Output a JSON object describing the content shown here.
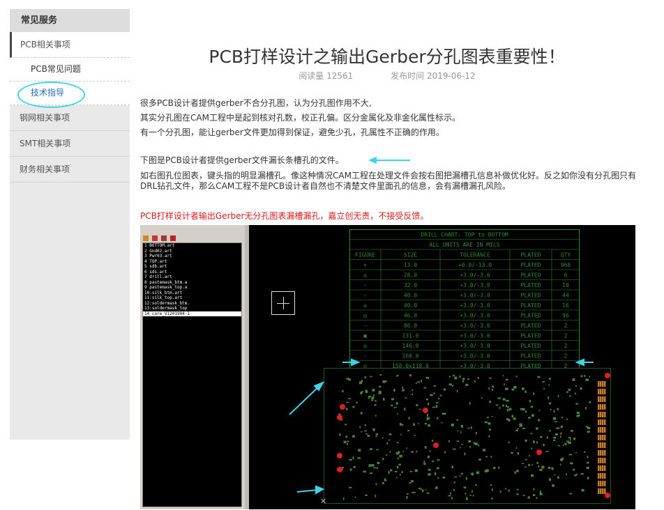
{
  "sidebar": {
    "header": "常见服务",
    "items": [
      {
        "label": "PCB相关事项"
      },
      {
        "label": "PCB常见问题"
      },
      {
        "label": "技术指导"
      },
      {
        "label": "钢网相关事项"
      },
      {
        "label": "SMT相关事项"
      },
      {
        "label": "财务相关事项"
      }
    ]
  },
  "article": {
    "title": "PCB打样设计之输出Gerber分孔图表重要性！",
    "views": "阅读量 12561",
    "date": "发布时间 2019-06-12",
    "p1": "很多PCB设计者提供gerber不合分孔图，认为分孔图作用不大,",
    "p2": "其实分孔图在CAM工程中是起到核对孔数，校正孔偏。区分金属化及非金化属性标示。",
    "p3": "有一个分孔图，能让gerber文件更加得到保证，避免少孔，孔属性不正确的作用。",
    "p4": "下图是PCB设计者提供gerber文件漏长条槽孔的文件。",
    "p5": "如右图孔位图表，键头指的明显漏槽孔。像这种情况CAM工程在处理文件会按右图把漏槽孔信息补做优化好。反之如你没有分孔图只有DRL钻孔文件，那么CAM工程不是PCB设计者自然也不清楚文件里面孔的信息，会有漏槽漏孔风险。",
    "p6": "PCB打样设计者输出Gerber无分孔图表漏槽漏孔，嘉立创无责，不接受反馈。"
  },
  "layers": [
    "1 BOTTOM.art",
    "2 Gnd02.art",
    "3 Pwr03.art",
    "4 TOP.art",
    "5 sdb.art",
    "6 sds.art",
    "7 drill.art",
    "8 pastemask_btm.a",
    "9 pastemask_top.a",
    "10:silk_btm.art",
    "11:silk_top.art",
    "12:soldermask_btm.",
    "13:soldermask_top",
    "14 care_V1201904-1"
  ],
  "drill_chart": {
    "title1": "DRILL CHART: TOP to BOTTOM",
    "title2": "ALL UNITS ARE IN MILS",
    "headers": [
      "FIGURE",
      "SIZE",
      "TOLERANCE",
      "PLATED",
      "QTY"
    ],
    "rows": [
      [
        "+",
        "13.0",
        "+0.0/-13.0",
        "PLATED",
        "968"
      ],
      [
        "◎",
        "28.0",
        "+3.0/-3.0",
        "PLATED",
        "6"
      ],
      [
        "·",
        "32.0",
        "+3.0/-3.0",
        "PLATED",
        "10"
      ],
      [
        "·",
        "40.0",
        "+3.0/-3.0",
        "PLATED",
        "44"
      ],
      [
        "◎",
        "40.0",
        "+3.0/-3.0",
        "PLATED",
        "16"
      ],
      [
        "◎",
        "46.0",
        "+3.0/-3.0",
        "PLATED",
        "96"
      ],
      [
        "·",
        "86.0",
        "+3.0/-3.0",
        "PLATED",
        "2"
      ],
      [
        "▣",
        "131.0",
        "+3.0/-3.0",
        "PLATED",
        "2"
      ],
      [
        "◎",
        "146.0",
        "+3.0/-3.0",
        "PLATED",
        "2"
      ],
      [
        "·",
        "160.0",
        "+3.0/-3.0",
        "PLATED",
        "2"
      ],
      [
        "◎",
        "158.0x118.0",
        "+3.0/-3.0",
        "PLATED",
        "2"
      ]
    ]
  },
  "colors": {
    "accent": "#3ed3e6",
    "red": "#d71a1a",
    "pcb_green": "#2f8a2f"
  }
}
